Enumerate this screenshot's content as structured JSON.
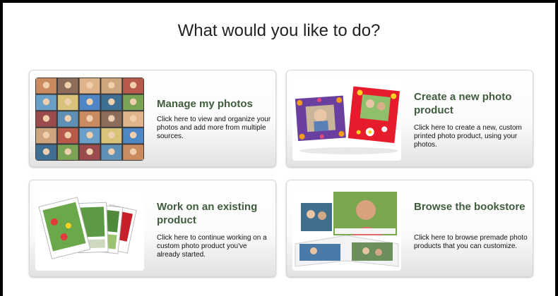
{
  "page": {
    "title": "What would you like to do?"
  },
  "cards": [
    {
      "heading": "Manage my photos",
      "description": "Click here to view and organize your photos and add more from multiple sources.",
      "thumbnail_icon": "photo-collage-icon"
    },
    {
      "heading": "Create a new photo product",
      "description": "Click here to create a new, custom printed photo product, using your photos.",
      "thumbnail_icon": "photo-frames-icon"
    },
    {
      "heading": "Work on an existing product",
      "description": "Click here to continue working on a custom photo product you've already started.",
      "thumbnail_icon": "photo-cards-icon"
    },
    {
      "heading": "Browse the bookstore",
      "description": "Click here to browse premade photo products that you can customize.",
      "thumbnail_icon": "photo-book-icon"
    }
  ],
  "colors": {
    "heading": "#3f5c3d",
    "border": "#000000"
  }
}
